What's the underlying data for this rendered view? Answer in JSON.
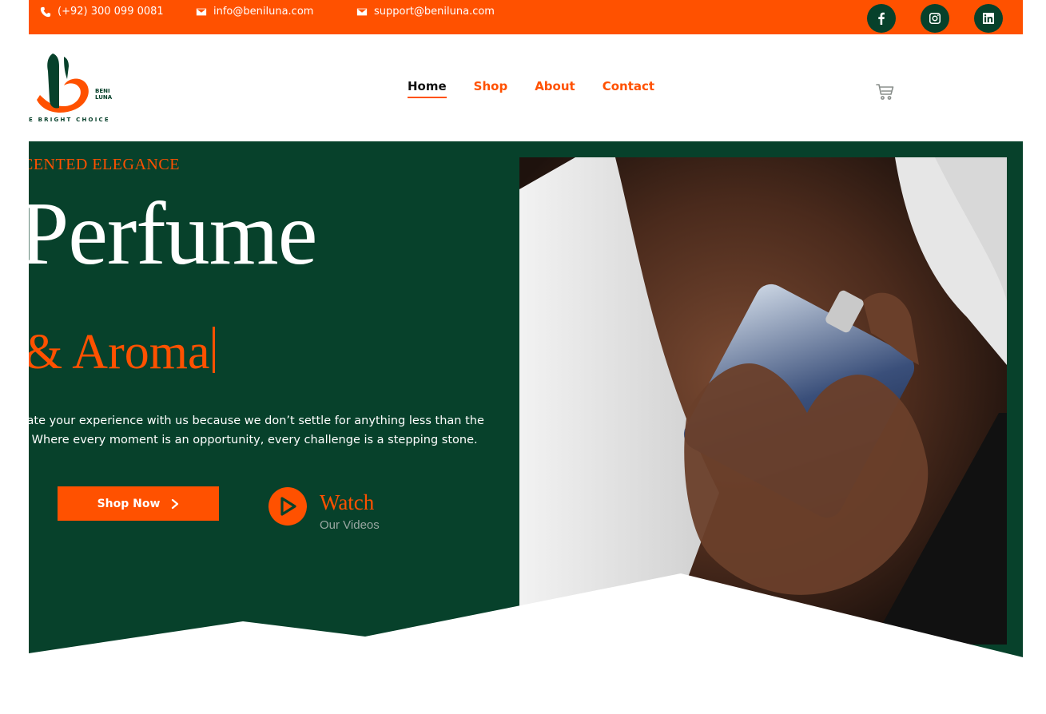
{
  "topbar": {
    "phone": "(+92) 300 099 0081",
    "email_info": "info@beniluna.com",
    "email_support": "support@beniluna.com",
    "social": [
      "facebook-icon",
      "instagram-icon",
      "linkedin-icon"
    ]
  },
  "header": {
    "logo_text_top": "BENI",
    "logo_text_bottom": "LUNA",
    "logo_tagline": "E BRIGHT CHOICE",
    "nav": [
      "Home",
      "Shop",
      "About",
      "Contact"
    ],
    "active_nav": "Home"
  },
  "hero": {
    "eyebrow": "CENTED ELEGANCE",
    "title": "Perfume",
    "subtitle": "& Aroma",
    "desc_line1": "evate your experience with us because we don’t settle for anything less than the",
    "desc_line2": "st! Where every moment is an opportunity, every challenge is a stepping stone.",
    "shop_button": "Shop Now",
    "watch_title": "Watch",
    "watch_sub": "Our Videos"
  },
  "colors": {
    "accent": "#ff5100",
    "brand_green": "#07412b",
    "white": "#ffffff"
  }
}
